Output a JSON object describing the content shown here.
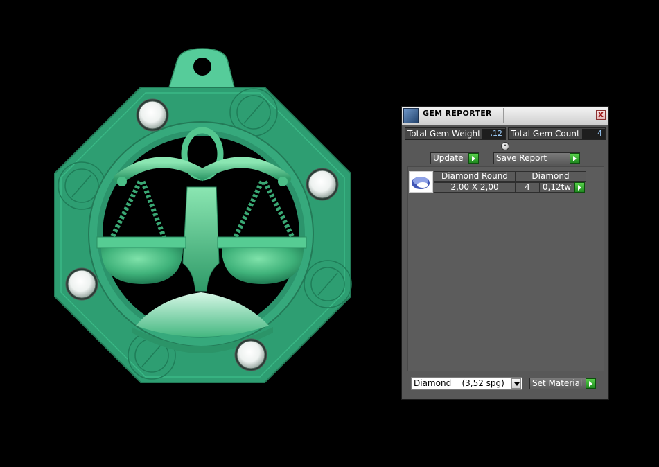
{
  "panel": {
    "title": "GEM REPORTER",
    "close_glyph": "x",
    "total_gem_weight_label": "Total Gem Weight",
    "total_gem_weight_value": ",12",
    "total_gem_count_label": "Total Gem Count",
    "total_gem_count_value": "4",
    "update_label": "Update",
    "save_report_label": "Save Report",
    "gems": [
      {
        "shape": "Diamond Round",
        "material": "Diamond",
        "size": "2,00 X 2,00",
        "count": "4",
        "weight": "0,12tw"
      }
    ],
    "material_select_value": "Diamond    (3,52 spg)",
    "set_material_label": "Set Material"
  },
  "colors": {
    "pendant_green": "#2e9e72",
    "panel_bg": "#585858",
    "value_text": "#9fd0ff",
    "go_button": "#2fa52f"
  },
  "icons": [
    "gem-reporter-icon",
    "close-icon",
    "slider-knob-icon",
    "play-arrow-icon",
    "gem-thumbnail-icon",
    "dropdown-arrow-icon"
  ]
}
